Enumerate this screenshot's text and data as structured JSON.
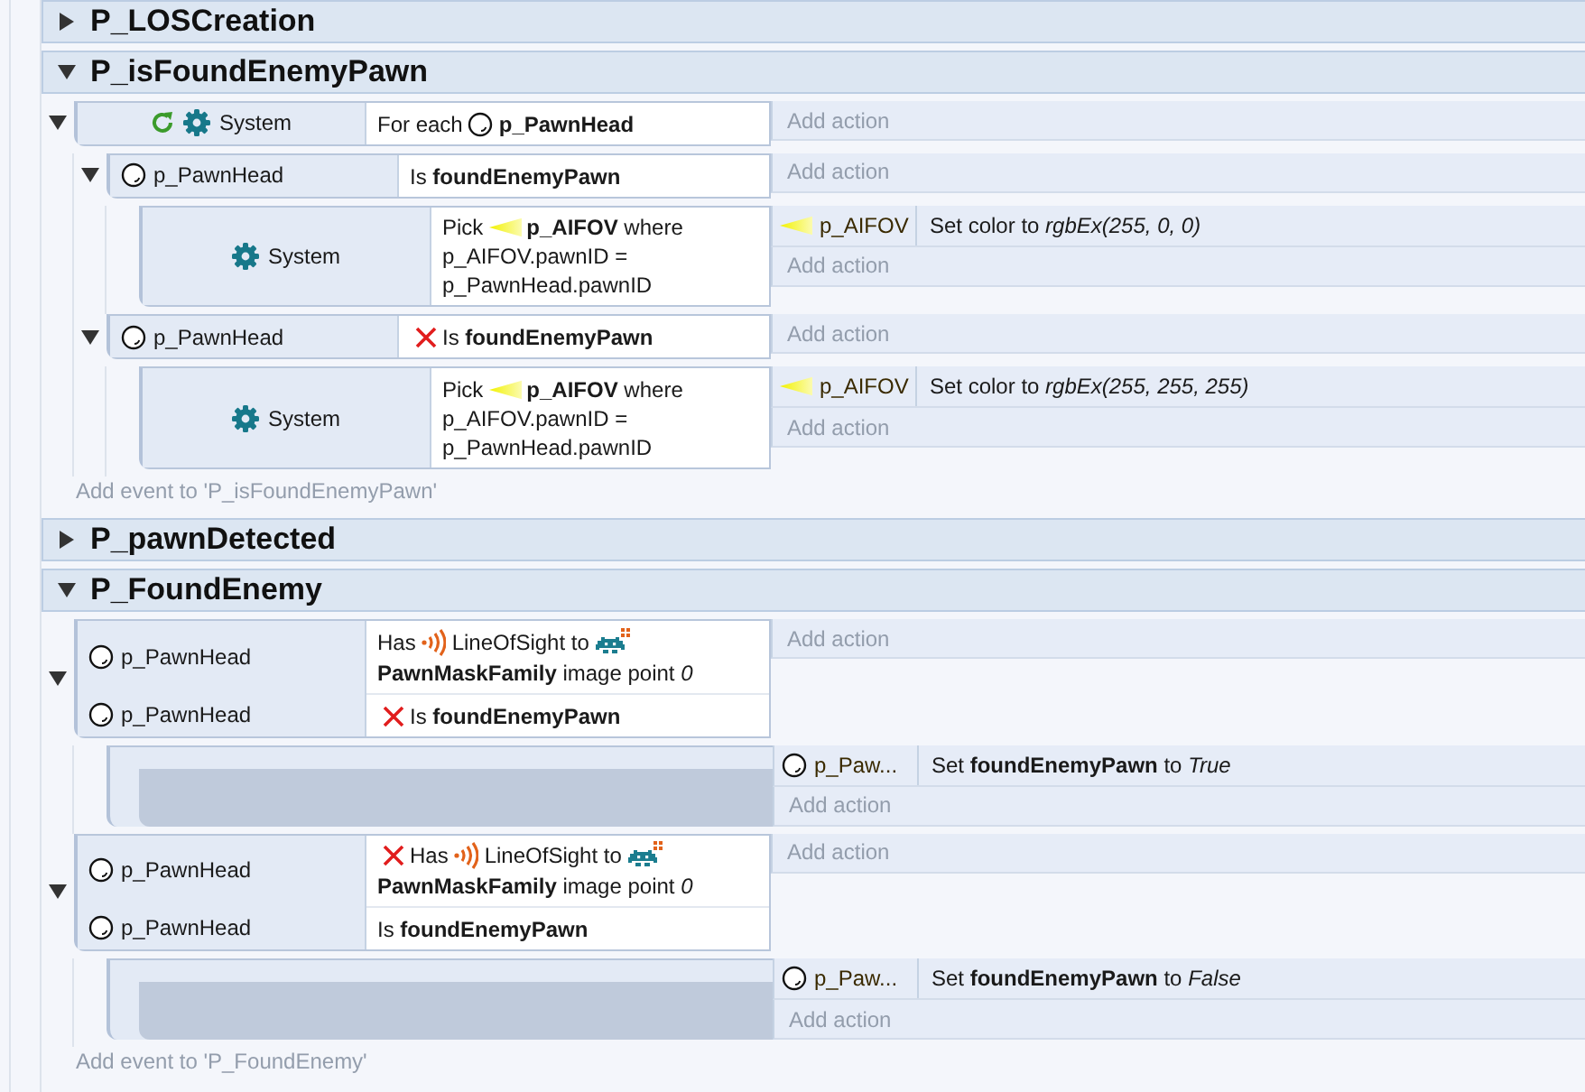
{
  "groups": [
    {
      "title": "P_LOSCreation",
      "expanded": false
    },
    {
      "title": "P_isFoundEnemyPawn",
      "expanded": true,
      "add_event": "Add event to 'P_isFoundEnemyPawn'",
      "events": [
        {
          "expanded": true,
          "conditions": [
            {
              "object": "System",
              "kind": "system",
              "loop": true,
              "inverted": false,
              "parts": [
                {
                  "text": "For each"
                },
                {
                  "kind": "sprite"
                },
                {
                  "text": "**p_PawnHead**"
                }
              ]
            }
          ],
          "add_action": "Add action",
          "children": [
            {
              "expanded": true,
              "conditions": [
                {
                  "object": "p_PawnHead",
                  "kind": "sprite",
                  "loop": false,
                  "inverted": false,
                  "parts": [
                    {
                      "text": "Is **foundEnemyPawn**"
                    }
                  ]
                }
              ],
              "add_action": "Add action",
              "children": [
                {
                  "conditions": [
                    {
                      "object": "System",
                      "kind": "system",
                      "loop": false,
                      "inverted": false,
                      "parts": [
                        {
                          "text": "Pick"
                        },
                        {
                          "kind": "cone"
                        },
                        {
                          "text": "**p_AIFOV** where"
                        },
                        {
                          "text": "p_AIFOV.pawnID = p_PawnHead.pawnID"
                        }
                      ]
                    }
                  ],
                  "actions": [
                    {
                      "object": "p_AIFOV",
                      "kind": "cone",
                      "text": "Set color to *rgbEx(255, 0, 0)*"
                    }
                  ],
                  "add_action": "Add action"
                }
              ]
            },
            {
              "expanded": true,
              "conditions": [
                {
                  "object": "p_PawnHead",
                  "kind": "sprite",
                  "loop": false,
                  "inverted": true,
                  "parts": [
                    {
                      "text": "Is **foundEnemyPawn**"
                    }
                  ]
                }
              ],
              "add_action": "Add action",
              "children": [
                {
                  "conditions": [
                    {
                      "object": "System",
                      "kind": "system",
                      "loop": false,
                      "inverted": false,
                      "parts": [
                        {
                          "text": "Pick"
                        },
                        {
                          "kind": "cone"
                        },
                        {
                          "text": "**p_AIFOV** where"
                        },
                        {
                          "text": "p_AIFOV.pawnID = p_PawnHead.pawnID"
                        }
                      ]
                    }
                  ],
                  "actions": [
                    {
                      "object": "p_AIFOV",
                      "kind": "cone",
                      "text": "Set color to *rgbEx(255, 255, 255)*"
                    }
                  ],
                  "add_action": "Add action"
                }
              ]
            }
          ]
        }
      ]
    },
    {
      "title": "P_pawnDetected",
      "expanded": false
    },
    {
      "title": "P_FoundEnemy",
      "expanded": true,
      "add_event": "Add event to 'P_FoundEnemy'",
      "events": [
        {
          "expanded": true,
          "conditions": [
            {
              "object": "p_PawnHead",
              "kind": "sprite",
              "loop": false,
              "inverted": false,
              "parts": [
                {
                  "text": "Has"
                },
                {
                  "kind": "signal"
                },
                {
                  "text": "LineOfSight to"
                },
                {
                  "kind": "family"
                },
                {
                  "text": "**PawnMaskFamily** image point *0*"
                }
              ]
            },
            {
              "object": "p_PawnHead",
              "kind": "sprite",
              "loop": false,
              "inverted": true,
              "parts": [
                {
                  "text": "Is **foundEnemyPawn**"
                }
              ]
            }
          ],
          "add_action": "Add action",
          "children": [
            {
              "actions": [
                {
                  "object": "p_Paw...",
                  "kind": "sprite",
                  "text": "Set **foundEnemyPawn** to *True*"
                }
              ],
              "add_action": "Add action"
            }
          ]
        },
        {
          "expanded": true,
          "conditions": [
            {
              "object": "p_PawnHead",
              "kind": "sprite",
              "loop": false,
              "inverted": true,
              "parts": [
                {
                  "text": "Has"
                },
                {
                  "kind": "signal"
                },
                {
                  "text": "LineOfSight to"
                },
                {
                  "kind": "family"
                },
                {
                  "text": "**PawnMaskFamily** image point *0*"
                }
              ]
            },
            {
              "object": "p_PawnHead",
              "kind": "sprite",
              "loop": false,
              "inverted": false,
              "parts": [
                {
                  "text": "Is **foundEnemyPawn**"
                }
              ]
            }
          ],
          "add_action": "Add action",
          "children": [
            {
              "actions": [
                {
                  "object": "p_Paw...",
                  "kind": "sprite",
                  "text": "Set **foundEnemyPawn** to *False*"
                }
              ],
              "add_action": "Add action"
            }
          ]
        }
      ]
    }
  ]
}
